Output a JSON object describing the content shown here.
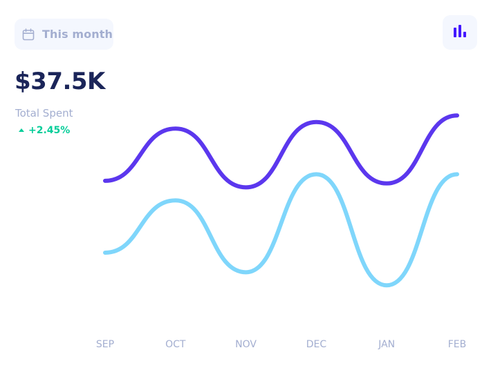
{
  "date_filter": {
    "label": "This month",
    "icon": "calendar-icon"
  },
  "chart_toggle": {
    "icon": "bar-chart-icon"
  },
  "summary": {
    "amount": "$37.5K",
    "label": "Total Spent",
    "delta": "+2.45%",
    "delta_icon": "arrow-up-icon"
  },
  "colors": {
    "accent_bg": "#F4F7FE",
    "text_primary": "#1B2559",
    "text_muted": "#A3AED0",
    "positive": "#05CD99",
    "series_1": "#5B37EE",
    "series_2": "#7FD6FB"
  },
  "chart_data": {
    "type": "line",
    "categories": [
      "SEP",
      "OCT",
      "NOV",
      "DEC",
      "JAN",
      "FEB"
    ],
    "series": [
      {
        "values": [
          0.8,
          1.2,
          0.75,
          1.25,
          0.78,
          1.3
        ]
      },
      {
        "values": [
          0.25,
          0.65,
          0.1,
          0.85,
          0.0,
          0.85
        ]
      }
    ],
    "ylim": [
      -0.3,
      1.55
    ],
    "grid": false,
    "legend": "none",
    "curve": "smooth"
  }
}
